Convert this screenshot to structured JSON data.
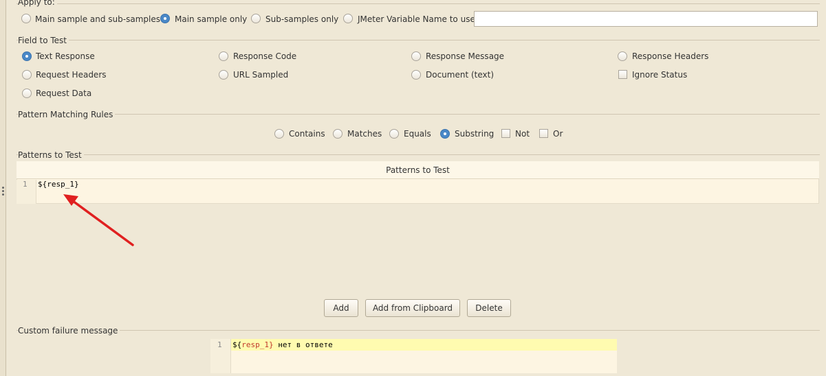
{
  "apply_to": {
    "label": "Apply to:",
    "options": [
      "Main sample and sub-samples",
      "Main sample only",
      "Sub-samples only",
      "JMeter Variable Name to use"
    ],
    "selected": 1,
    "variable_value": ""
  },
  "field_to_test": {
    "label": "Field to Test",
    "options": [
      "Text Response",
      "Response Code",
      "Response Message",
      "Response Headers",
      "Request Headers",
      "URL Sampled",
      "Document (text)",
      "Request Data"
    ],
    "ignore_status_label": "Ignore Status",
    "selected": 0
  },
  "pattern_matching_rules": {
    "label": "Pattern Matching Rules",
    "options": [
      "Contains",
      "Matches",
      "Equals",
      "Substring"
    ],
    "selected": 3,
    "not_label": "Not",
    "or_label": "Or"
  },
  "patterns_to_test": {
    "section_label": "Patterns to Test",
    "column_header": "Patterns to Test",
    "lines": [
      {
        "num": "1",
        "text": "${resp_1}"
      }
    ]
  },
  "buttons": {
    "add": "Add",
    "add_from_clipboard": "Add from Clipboard",
    "delete": "Delete"
  },
  "custom_failure_message": {
    "label": "Custom failure message",
    "line_num": "1",
    "var_open": "${",
    "var_name": "resp_1",
    "var_close": "}",
    "text_rest": " нет в ответе"
  },
  "colors": {
    "background": "#efe8d6",
    "selected_radio": "#4a88c7",
    "annotation_arrow": "#e02020",
    "line_highlight": "#fffbb0"
  }
}
